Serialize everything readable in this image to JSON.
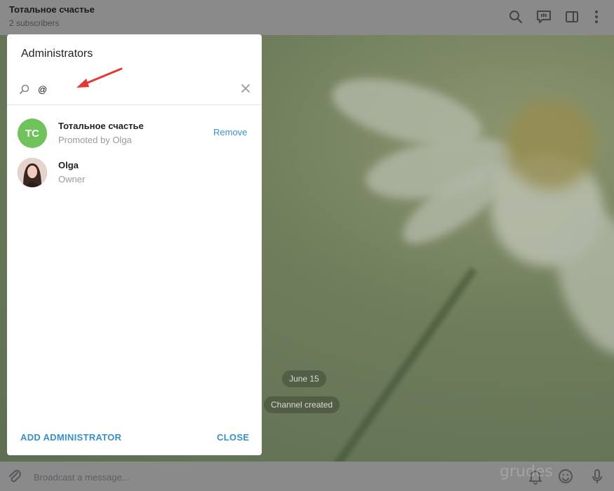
{
  "header": {
    "title": "Тотальное счастье",
    "subtitle": "2 subscribers",
    "icons": [
      "search-icon",
      "discussion-icon",
      "sidebar-toggle-icon",
      "more-vert-icon"
    ]
  },
  "chat": {
    "date_label": "June 15",
    "service_message": "Channel created"
  },
  "modal": {
    "title": "Administrators",
    "search": {
      "value": "@",
      "placeholder": ""
    },
    "admins": [
      {
        "initials": "TC",
        "name": "Тотальное счастье",
        "role": "Promoted by Olga",
        "action": "Remove",
        "avatar_color": "#6fc35a"
      },
      {
        "initials": "",
        "name": "Olga",
        "role": "Owner",
        "action": ""
      }
    ],
    "add_button": "ADD ADMINISTRATOR",
    "close_button": "CLOSE"
  },
  "composer": {
    "placeholder": "Broadcast a message..."
  },
  "watermark": "grudes",
  "colors": {
    "accent": "#3a8fcb",
    "annotation_arrow": "#e53935"
  }
}
